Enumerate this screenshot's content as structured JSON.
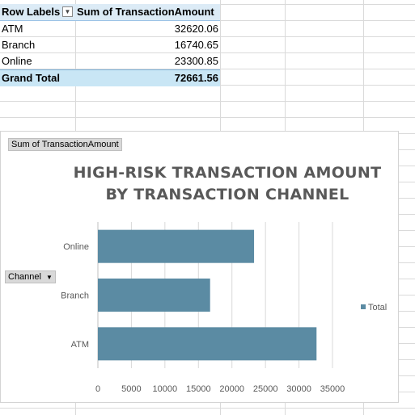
{
  "pivot": {
    "header_row_labels": "Row Labels",
    "header_value": "Sum of TransactionAmount",
    "filter_icon": "dropdown-arrow-icon",
    "rows": [
      {
        "label": "ATM",
        "value": "32620.06"
      },
      {
        "label": "Branch",
        "value": "16740.65"
      },
      {
        "label": "Online",
        "value": "23300.85"
      }
    ],
    "total_label": "Grand Total",
    "total_value": "72661.56"
  },
  "chart": {
    "value_field_button": "Sum of TransactionAmount",
    "axis_field_button": "Channel",
    "title_line1": "HIGH-RISK TRANSACTION AMOUNT",
    "title_line2": "BY TRANSACTION CHANNEL"
  },
  "chart_data": {
    "type": "bar",
    "orientation": "horizontal",
    "categories": [
      "ATM",
      "Branch",
      "Online"
    ],
    "series": [
      {
        "name": "Total",
        "values": [
          32620.06,
          16740.65,
          23300.85
        ],
        "color": "#5b8ba3"
      }
    ],
    "title": "HIGH-RISK TRANSACTION AMOUNT BY TRANSACTION CHANNEL",
    "xlim": [
      0,
      35000
    ],
    "xticks": [
      0,
      5000,
      10000,
      15000,
      20000,
      25000,
      30000,
      35000
    ],
    "grid": true,
    "legend": "right"
  }
}
